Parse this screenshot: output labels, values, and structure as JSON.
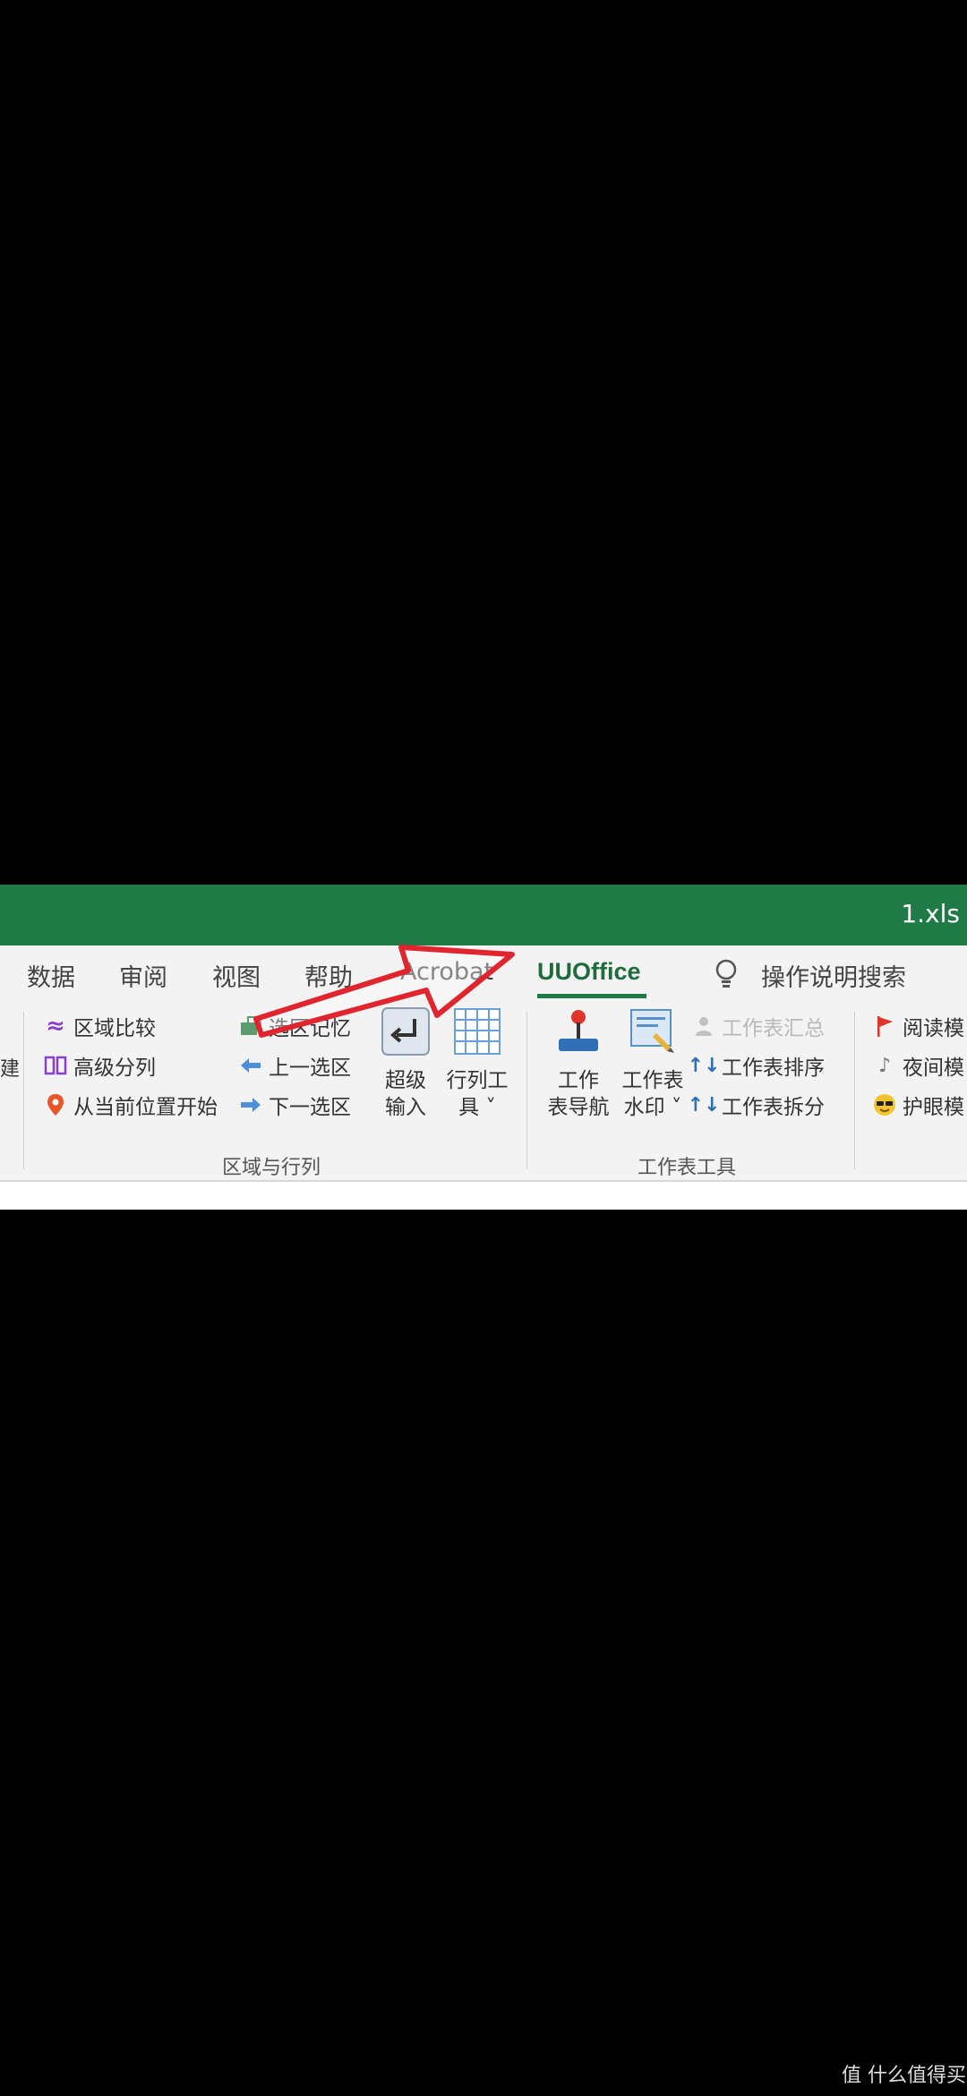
{
  "window": {
    "filename": "1.xls"
  },
  "tabs": [
    {
      "label": "数据"
    },
    {
      "label": "审阅"
    },
    {
      "label": "视图"
    },
    {
      "label": "帮助"
    },
    {
      "label": "Acrobat"
    },
    {
      "label": "UUOffice"
    },
    {
      "label": "操作说明搜索"
    }
  ],
  "active_tab": "UUOffice",
  "left_partial_char": "建",
  "ribbon": {
    "group1": {
      "label": "区域与行列",
      "col1": [
        {
          "label": "区域比较"
        },
        {
          "label": "高级分列"
        },
        {
          "label": "从当前位置开始"
        }
      ],
      "col2": [
        {
          "label": "选区记忆"
        },
        {
          "label": "上一选区"
        },
        {
          "label": "下一选区"
        }
      ],
      "big_buttons": [
        {
          "line1": "超级",
          "line2": "输入"
        },
        {
          "line1": "行列工",
          "line2": "具 ˅"
        }
      ]
    },
    "group2": {
      "label": "工作表工具",
      "big_buttons": [
        {
          "line1": "工作",
          "line2": "表导航"
        },
        {
          "line1": "工作表",
          "line2": "水印 ˅"
        }
      ],
      "col": [
        {
          "label": "工作表汇总",
          "disabled": true
        },
        {
          "label": "工作表排序"
        },
        {
          "label": "工作表拆分"
        }
      ]
    },
    "group3": {
      "col": [
        {
          "label": "阅读模"
        },
        {
          "label": "夜间模"
        },
        {
          "label": "护眼模"
        }
      ]
    }
  },
  "watermark": "值 什么值得买",
  "colors": {
    "excel_green": "#1f7a46",
    "annotation_arrow": "#e0252f"
  }
}
